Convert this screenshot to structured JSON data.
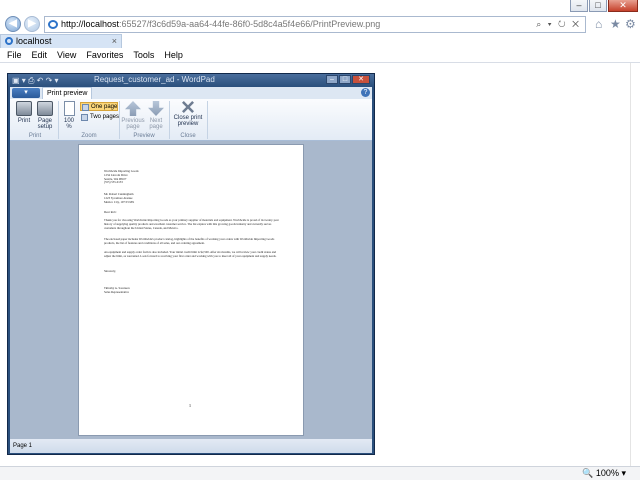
{
  "browser": {
    "address_host": "http://localhost",
    "address_path": ":65527/f3c6d59a-aa64-44fe-86f0-5d8c4a5f4e66/PrintPreview.png",
    "addr_tools": "⌕ ▾ ↻ ✕",
    "tab_label": "localhost",
    "menu": [
      "File",
      "Edit",
      "View",
      "Favorites",
      "Tools",
      "Help"
    ],
    "zoom": "100%",
    "zoom_glyph": "🔍",
    "back_glyph": "◀",
    "forward_glyph": "▶",
    "home_glyph": "⌂",
    "star_glyph": "★",
    "gear_glyph": "⚙",
    "tab_close": "×"
  },
  "wordpad": {
    "title": "Request_customer_ad - WordPad",
    "app_menu": "▾",
    "ribbon_tab": "Print preview",
    "help": "?",
    "buttons": {
      "print": "Print",
      "page_setup_1": "Page",
      "page_setup_2": "setup",
      "zoom_1": "100",
      "zoom_2": "%",
      "one_page": "One page",
      "two_pages": "Two pages",
      "previous_1": "Previous",
      "previous_2": "page",
      "next_1": "Next",
      "next_2": "page",
      "close_1": "Close print",
      "close_2": "preview"
    },
    "groups": {
      "print": "Print",
      "zoom": "Zoom",
      "preview": "Preview",
      "close": "Close"
    },
    "status": "Page 1"
  },
  "document": {
    "sender": [
      "Worldwide Importing Goods",
      "1234 Lincoln Drive",
      "Seattle, WA 98107",
      "(555) 555-0133"
    ],
    "recipient": [
      "Mr. Robert Cunningham",
      "1223 Sycamore Avenue",
      "Mexico City, 107 03 MX"
    ],
    "salutation": "Dear Rob:",
    "para1": "Thank you for choosing Worldwide Importing Goods as your primary supplier of materials and equipment. Worldwide is proud of its twenty-year history of supplying quality products and excellent customer service. The list expires with this growing goods industry and currently serves customers throughout the United States, Canada, and Mexico.",
    "para2": "The enclosed paper includes Worldwide's product catalog, highlights of the benefits of working your orders with Worldwide Importing Goods products, the list of features and conditions of all sales, and our ordering agreement.",
    "para3": "An equipment and supply order form is also included. Your initial credit limit is $2,500. After six months, we will review your credit status and adjust the limit, as warranted. Look forward to receiving your first order and working with you to meet all of your equipment and supply needs.",
    "closing": "Sincerely,",
    "signature": [
      "Timothy A. Sorenson",
      "Sales Representative"
    ],
    "page_number": "1"
  }
}
